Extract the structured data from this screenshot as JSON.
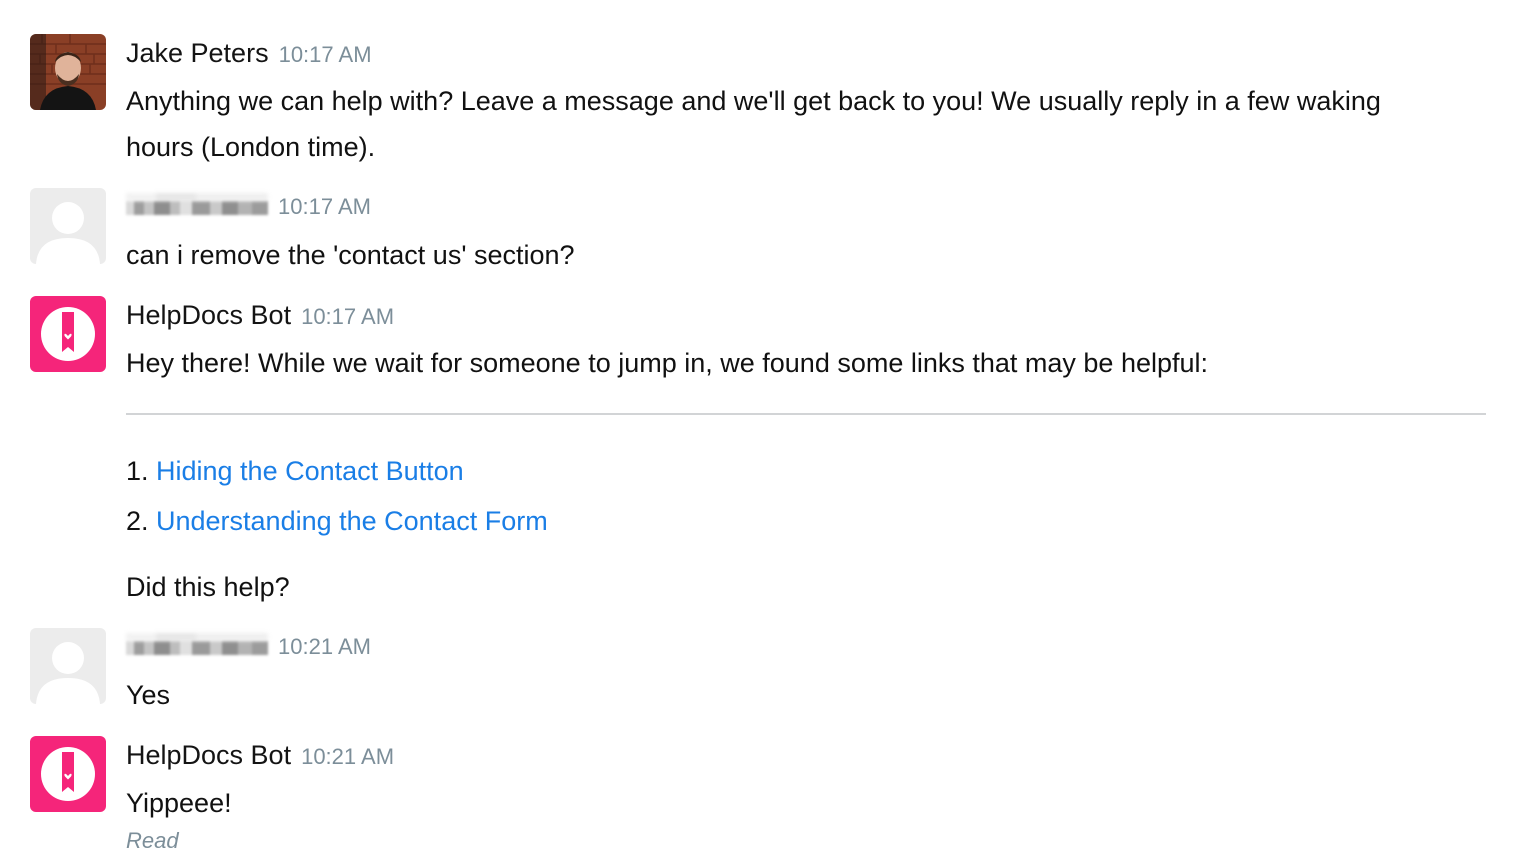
{
  "messages": [
    {
      "author": "Jake Peters",
      "time": "10:17 AM",
      "avatar": "user-photo",
      "text": "Anything we can help with? Leave a message and we'll get back to you! We usually reply in a few waking hours (London time)."
    },
    {
      "author": "",
      "time": "10:17 AM",
      "avatar": "default-user-icon",
      "text": "can i remove the 'contact us' section?"
    },
    {
      "author": "HelpDocs Bot",
      "time": "10:17 AM",
      "avatar": "helpdocs-logo-icon",
      "text": "Hey there! While we wait for someone to jump in, we found some links that may be helpful:",
      "links": [
        {
          "number": "1.",
          "label": "Hiding the Contact Button"
        },
        {
          "number": "2.",
          "label": "Understanding the Contact Form"
        }
      ],
      "followup": "Did this help?"
    },
    {
      "author": "",
      "time": "10:21 AM",
      "avatar": "default-user-icon",
      "text": "Yes"
    },
    {
      "author": "HelpDocs Bot",
      "time": "10:21 AM",
      "avatar": "helpdocs-logo-icon",
      "text": "Yippeee!",
      "status": "Read"
    }
  ],
  "colors": {
    "brand_pink": "#f5257a",
    "link_blue": "#1a7ee6",
    "timestamp_gray": "#7c8e99"
  }
}
